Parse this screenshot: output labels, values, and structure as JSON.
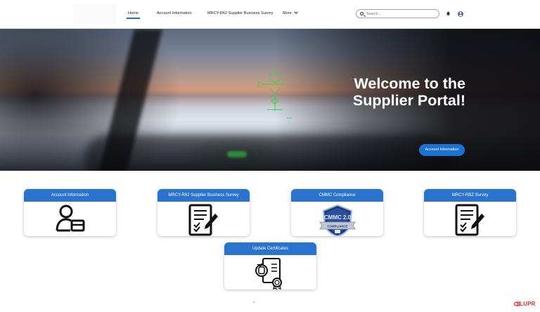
{
  "nav": {
    "items": [
      "Home",
      "Account Information",
      "MRCY-R62 Supplier Business Survey",
      "More"
    ],
    "active": "Home"
  },
  "search": {
    "placeholder": "Search..."
  },
  "icons": {
    "search": "search-icon",
    "notifications": "bell-icon",
    "profile": "user-avatar-icon"
  },
  "hero": {
    "title_line1": "Welcome to the",
    "title_line2": "Supplier Portal!",
    "button_label": "Account Information"
  },
  "cards": [
    {
      "title": "Account Information",
      "icon": "user-card-icon"
    },
    {
      "title": "MRCY-R62 Supplier Business Survey",
      "icon": "survey-form-icon"
    },
    {
      "title": "CMMC Compliance",
      "icon": "cmmc-badge-icon",
      "badge_text": "CMMC 2.0",
      "badge_ribbon": "COMPLIANCE"
    },
    {
      "title": "MRCY-RBZ Survey",
      "icon": "survey-form-icon"
    },
    {
      "title": "Update Certificates",
      "icon": "certificate-icon"
    }
  ],
  "footer": {
    "brand": "LUPR"
  },
  "colors": {
    "accent": "#2a74d0",
    "button": "#1b72d3",
    "brand": "#e52a2a"
  }
}
